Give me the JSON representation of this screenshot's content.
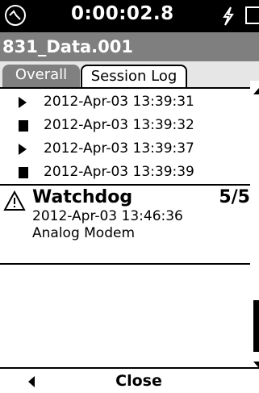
{
  "status_bar": {
    "timer": "0:00:02.8",
    "icons": [
      "measure-status-icon",
      "bolt-icon",
      "battery-icon"
    ]
  },
  "title_bar": {
    "title": "831_Data.001"
  },
  "tabs": [
    {
      "label": "Overall",
      "selected": false
    },
    {
      "label": "Session Log",
      "selected": true
    }
  ],
  "log_entries": [
    {
      "icon": "play-icon",
      "timestamp": "2012-Apr-03 13:39:31"
    },
    {
      "icon": "stop-icon",
      "timestamp": "2012-Apr-03 13:39:32"
    },
    {
      "icon": "play-icon",
      "timestamp": "2012-Apr-03 13:39:37"
    },
    {
      "icon": "stop-icon",
      "timestamp": "2012-Apr-03 13:39:39"
    }
  ],
  "watchdog": {
    "icon": "warning-icon",
    "title": "Watchdog",
    "count": "5/5",
    "timestamp": "2012-Apr-03 13:46:36",
    "description": "Analog Modem"
  },
  "footer": {
    "back_icon": "back-arrow-icon",
    "close_label": "Close"
  },
  "colors": {
    "status_bar_bg": "#000000",
    "title_bar_bg": "#7f7f7f",
    "tab_inactive_bg": "#808080"
  }
}
